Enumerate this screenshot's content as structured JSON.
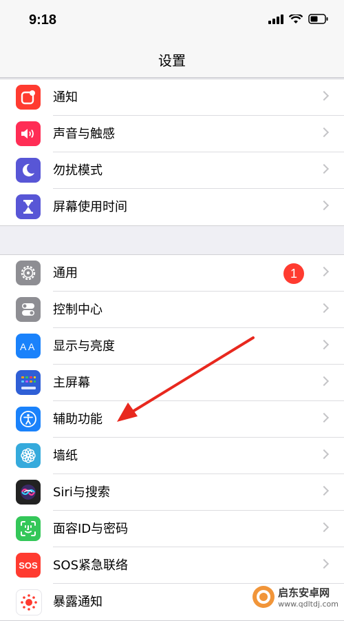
{
  "status": {
    "time": "9:18"
  },
  "nav": {
    "title": "设置"
  },
  "group1": [
    {
      "label": "通知",
      "icon": "notification-icon",
      "color": "#ff3b30"
    },
    {
      "label": "声音与触感",
      "icon": "speaker-icon",
      "color": "#ff2d55"
    },
    {
      "label": "勿扰模式",
      "icon": "moon-icon",
      "color": "#5856d6"
    },
    {
      "label": "屏幕使用时间",
      "icon": "hourglass-icon",
      "color": "#5856d6"
    }
  ],
  "group2": [
    {
      "label": "通用",
      "icon": "gear-icon",
      "color": "#8e8e93",
      "badge": "1"
    },
    {
      "label": "控制中心",
      "icon": "toggles-icon",
      "color": "#8e8e93"
    },
    {
      "label": "显示与亮度",
      "icon": "text-size-icon",
      "color": "#1a82fb"
    },
    {
      "label": "主屏幕",
      "icon": "home-grid-icon",
      "color": "#2f5fd6"
    },
    {
      "label": "辅助功能",
      "icon": "accessibility-icon",
      "color": "#1a82fb"
    },
    {
      "label": "墙纸",
      "icon": "flower-icon",
      "color": "#35aadc"
    },
    {
      "label": "Siri与搜索",
      "icon": "siri-icon",
      "color": "#222222"
    },
    {
      "label": "面容ID与密码",
      "icon": "face-id-icon",
      "color": "#34c759"
    },
    {
      "label": "SOS紧急联络",
      "icon": "sos-icon",
      "color": "#ff3b30",
      "icon_text": "SOS"
    },
    {
      "label": "暴露通知",
      "icon": "exposure-icon",
      "color": "#ffffff"
    }
  ],
  "watermark": {
    "text": "启东安卓网",
    "url": "www.qdltdj.com"
  }
}
